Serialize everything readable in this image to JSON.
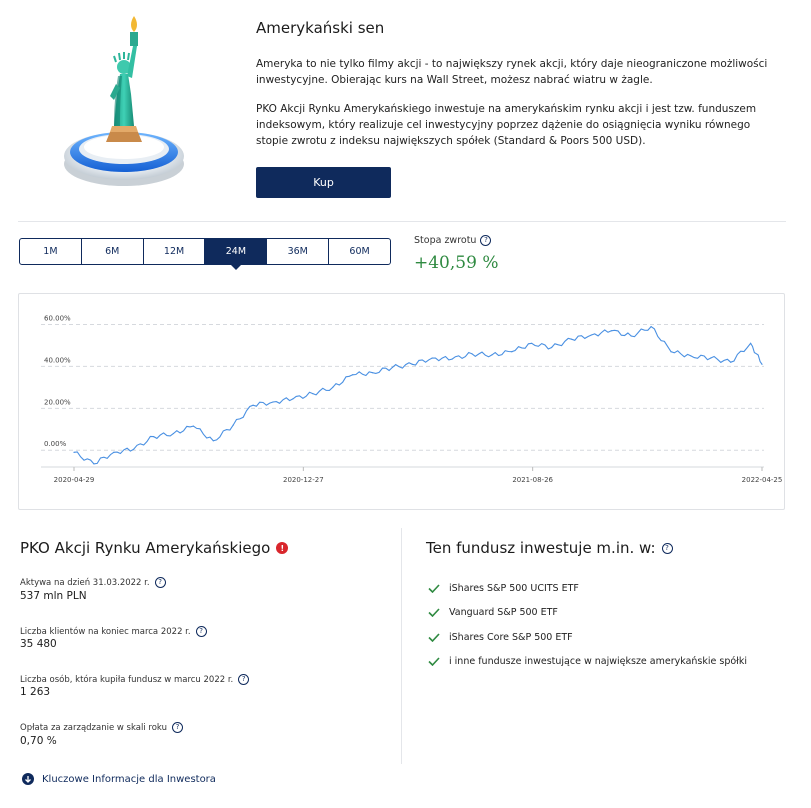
{
  "hero": {
    "title": "Amerykański sen",
    "paragraph1": "Ameryka to nie tylko filmy akcji - to największy rynek akcji, który daje nieograniczone możliwości inwestycyjne. Obierając kurs na Wall Street, możesz nabrać wiatru w żagle.",
    "paragraph2": "PKO Akcji Rynku Amerykańskiego inwestuje na amerykańskim rynku akcji i jest tzw. funduszem indeksowym, który realizuje cel inwestycyjny poprzez dążenie do osiągnięcia wyniku równego stopie zwrotu z indeksu największych spółek (Standard & Poors 500 USD).",
    "buy_label": "Kup",
    "image_icon": "statue-of-liberty-icon"
  },
  "periods": [
    "1M",
    "6M",
    "12M",
    "24M",
    "36M",
    "60M"
  ],
  "active_period": "24M",
  "return": {
    "label": "Stopa zwrotu",
    "value": "+40,59 %"
  },
  "colors": {
    "navy": "#0f2a5c",
    "positive": "#2f8a41",
    "line": "#4a90e2",
    "alert": "#d9262c"
  },
  "chart_data": {
    "type": "line",
    "title": "",
    "xlabel": "",
    "ylabel": "",
    "ylim": [
      -8,
      65
    ],
    "y_ticks": [
      "0.00%",
      "20.00%",
      "40.00%",
      "60.00%"
    ],
    "y_tick_values": [
      0,
      20,
      40,
      60
    ],
    "x_ticks": [
      "2020-04-29",
      "2020-12-27",
      "2021-08-26",
      "2022-04-25"
    ],
    "grid": true,
    "series": [
      {
        "x": [
          "2020-04-29",
          "2020-05-20",
          "2020-06-10",
          "2020-07-01",
          "2020-07-22",
          "2020-08-12",
          "2020-09-02",
          "2020-09-23",
          "2020-10-14",
          "2020-11-04",
          "2020-11-25",
          "2020-12-16",
          "2021-01-06",
          "2021-01-27",
          "2021-02-17",
          "2021-03-10",
          "2021-03-31",
          "2021-04-21",
          "2021-05-12",
          "2021-06-02",
          "2021-06-23",
          "2021-07-14",
          "2021-08-04",
          "2021-08-25",
          "2021-09-15",
          "2021-10-06",
          "2021-10-27",
          "2021-11-17",
          "2021-12-08",
          "2021-12-29",
          "2022-01-19",
          "2022-02-09",
          "2022-03-02",
          "2022-03-23",
          "2022-04-13",
          "2022-04-25"
        ],
        "values": [
          -1.0,
          -6.5,
          -1.0,
          0.5,
          6.5,
          8.0,
          11.5,
          4.5,
          12.0,
          21.5,
          23.0,
          24.5,
          27.0,
          30.0,
          36.0,
          37.0,
          39.5,
          41.0,
          44.0,
          43.5,
          46.0,
          45.5,
          47.0,
          51.0,
          49.0,
          53.0,
          55.0,
          57.0,
          54.5,
          59.0,
          47.0,
          45.0,
          44.0,
          42.0,
          51.0,
          41.0
        ]
      }
    ]
  },
  "fund": {
    "name": "PKO Akcji Rynku Amerykańskiego",
    "stats": [
      {
        "label": "Aktywa na dzień 31.03.2022 r.",
        "value": "537 mln PLN"
      },
      {
        "label": "Liczba klientów na koniec marca 2022 r.",
        "value": "35 480"
      },
      {
        "label": "Liczba osób, która kupiła fundusz w marcu 2022 r.",
        "value": "1 263"
      },
      {
        "label": "Opłata za zarządzanie w skali roku",
        "value": "0,70 %"
      }
    ]
  },
  "invests": {
    "title": "Ten fundusz inwestuje m.in. w:",
    "items": [
      "iShares S&P 500 UCITS ETF",
      "Vanguard S&P 500 ETF",
      "iShares Core S&P 500 ETF",
      "i inne fundusze inwestujące w największe amerykańskie spółki"
    ]
  },
  "kiid": {
    "label": "Kluczowe Informacje dla Inwestora"
  }
}
